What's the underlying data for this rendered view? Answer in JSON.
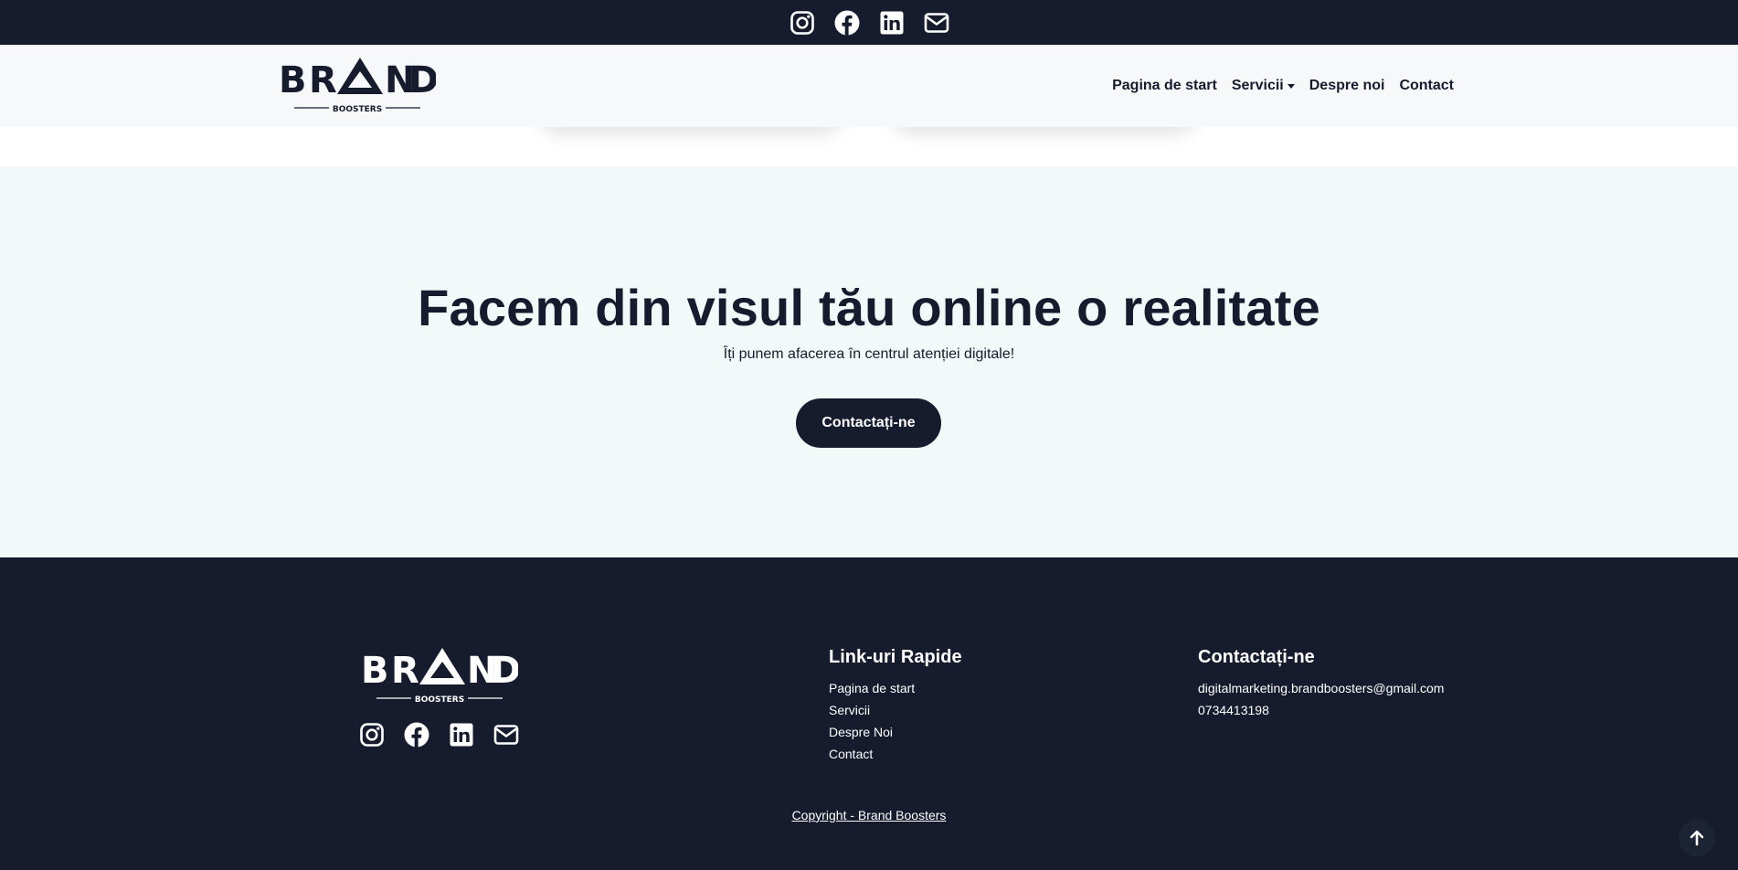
{
  "colors": {
    "dark": "#161c2d",
    "hero_bg": "#f1faf9",
    "nav_bg": "#f7f8fa",
    "white": "#ffffff"
  },
  "topbar": {
    "icons": [
      "instagram-icon",
      "facebook-icon",
      "linkedin-icon",
      "envelope-icon"
    ]
  },
  "brand": {
    "name": "BRAND",
    "tagline": "BOOSTERS"
  },
  "nav": {
    "home": "Pagina de start",
    "services": "Servicii",
    "about": "Despre noi",
    "contact": "Contact"
  },
  "hero": {
    "title": "Facem din visul tău online o realitate",
    "subtitle": "Îți punem afacerea în centrul atenției digitale!",
    "button": "Contactați-ne"
  },
  "footer": {
    "links_heading": "Link-uri Rapide",
    "links": [
      "Pagina de start",
      "Servicii",
      "Despre Noi",
      "Contact"
    ],
    "contact_heading": "Contactați-ne",
    "email": "digitalmarketing.brandboosters@gmail.com",
    "phone": "0734413198",
    "copyright": "Copyright - Brand Boosters"
  },
  "back_to_top": {
    "icon": "arrow-up-icon"
  }
}
